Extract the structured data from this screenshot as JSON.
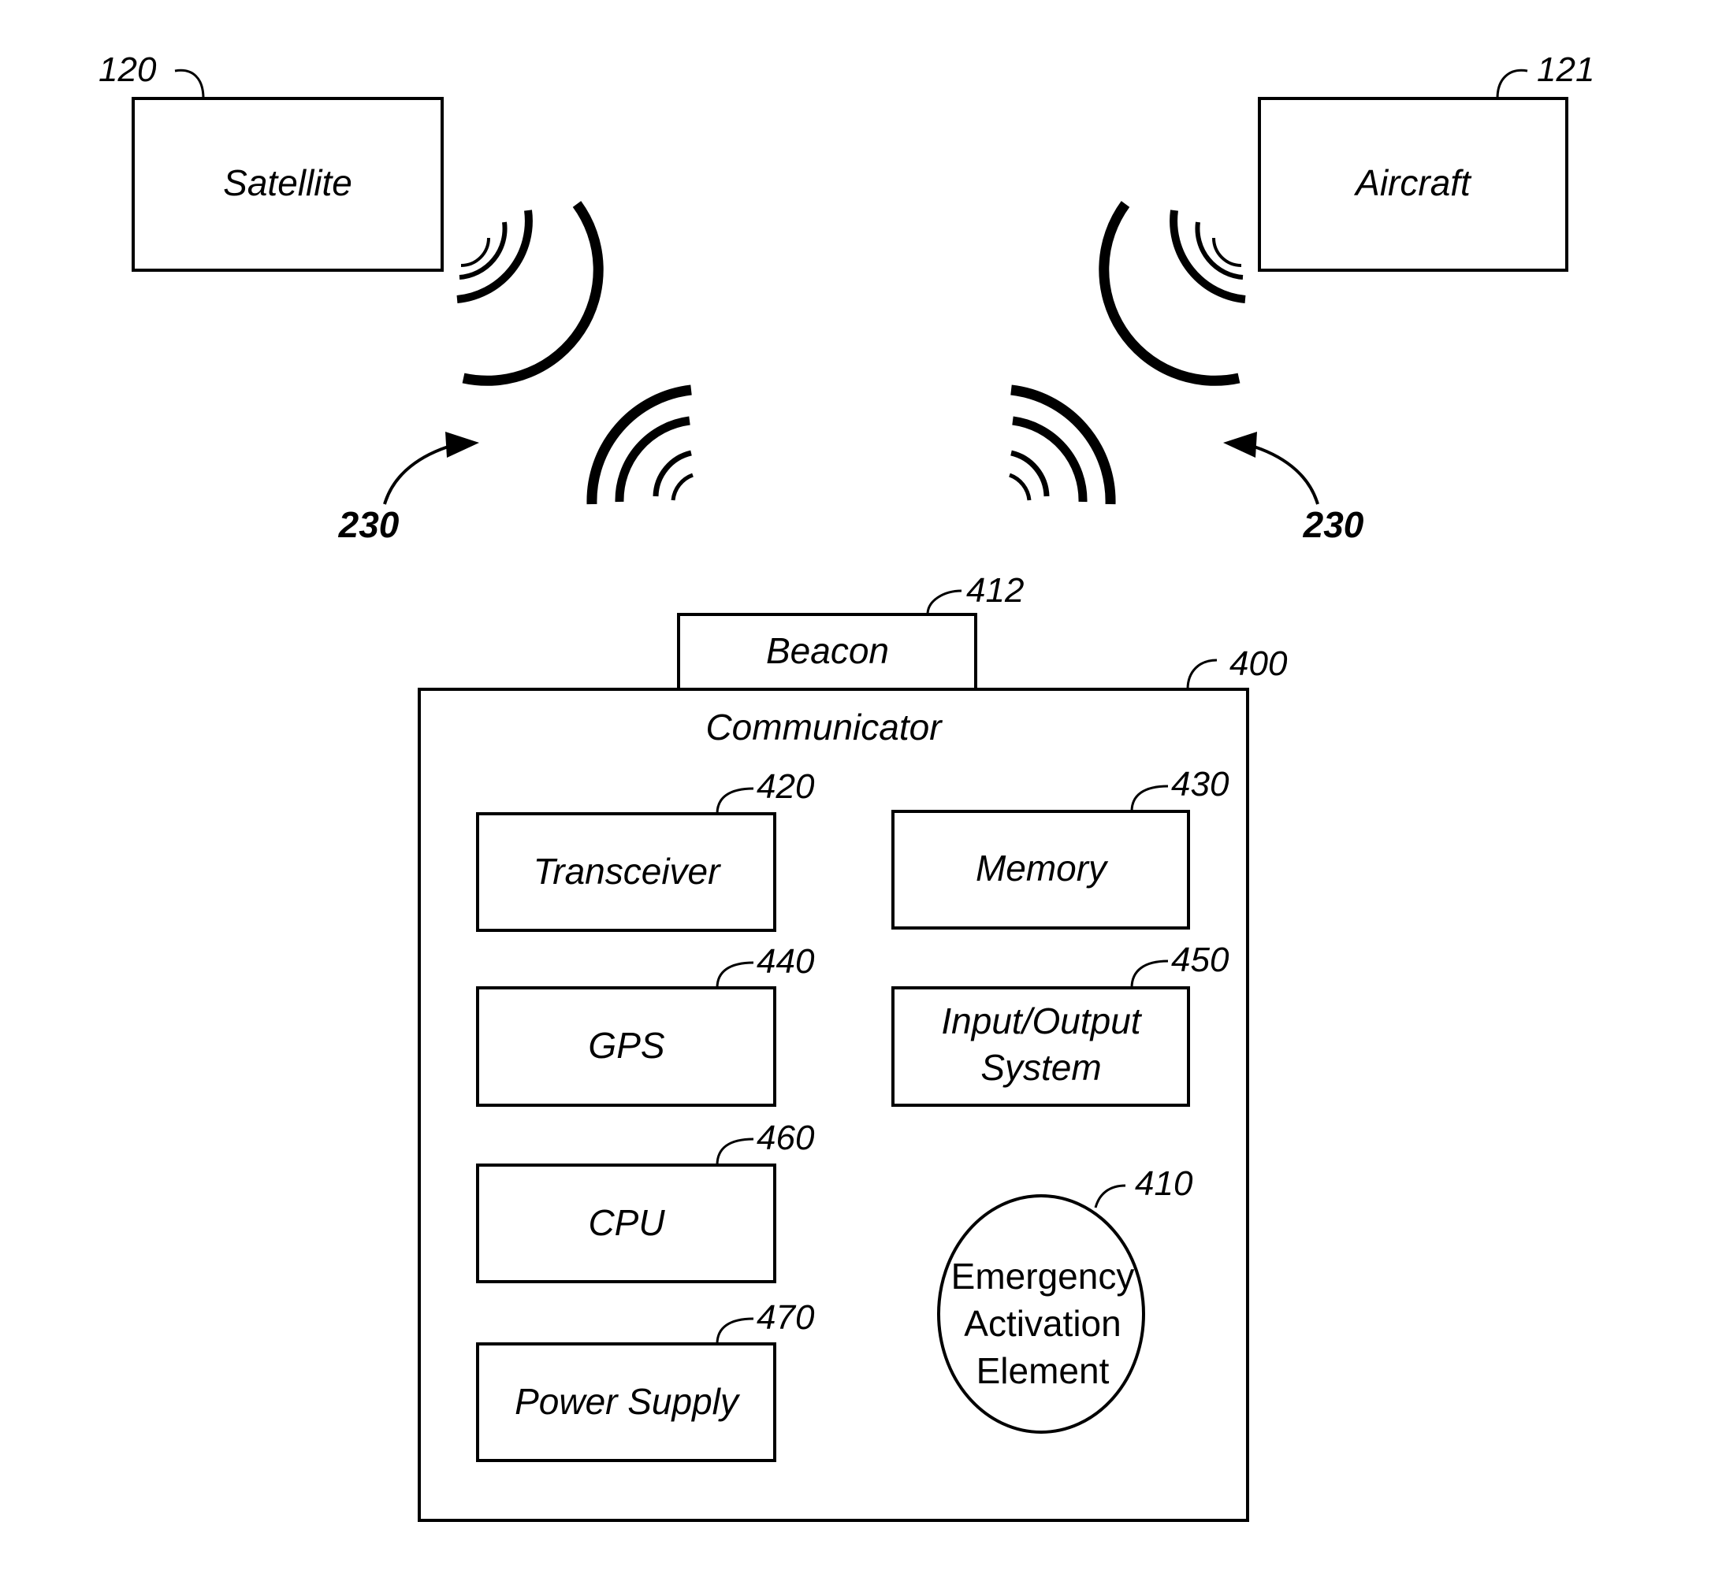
{
  "diagram": {
    "satellite": {
      "label": "Satellite",
      "ref": "120"
    },
    "aircraft": {
      "label": "Aircraft",
      "ref": "121"
    },
    "signal_ref_left": "230",
    "signal_ref_right": "230",
    "beacon": {
      "label": "Beacon",
      "ref": "412"
    },
    "communicator": {
      "label": "Communicator",
      "ref": "400",
      "components": [
        {
          "label": "Transceiver",
          "ref": "420"
        },
        {
          "label": "Memory",
          "ref": "430"
        },
        {
          "label": "GPS",
          "ref": "440"
        },
        {
          "label_line1": "Input/Output",
          "label_line2": "System",
          "ref": "450"
        },
        {
          "label": "CPU",
          "ref": "460"
        },
        {
          "label": "Power Supply",
          "ref": "470"
        }
      ],
      "emergency": {
        "line1": "Emergency",
        "line2": "Activation",
        "line3": "Element",
        "ref": "410"
      }
    }
  }
}
